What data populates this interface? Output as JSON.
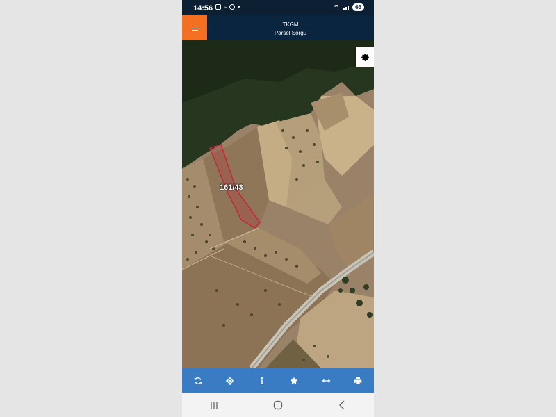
{
  "status_bar": {
    "time": "14:56",
    "battery": "66",
    "icons": [
      "screenshot-icon",
      "cast-icon",
      "messenger-icon",
      "dot-icon",
      "wifi-icon",
      "signal-icon",
      "battery-icon"
    ]
  },
  "header": {
    "title": "TKGM",
    "subtitle": "Parsel Sorgu",
    "menu_icon": "hamburger-icon",
    "accent_color": "#f36f21",
    "background_color": "#0a2540"
  },
  "map": {
    "parcel_label": "161/43",
    "parcel_color": "#c0283c",
    "settings_icon": "gear-icon"
  },
  "toolbar": {
    "background_color": "#3a7cc4",
    "buttons": [
      "refresh-icon",
      "locate-icon",
      "info-icon",
      "star-icon",
      "measure-icon",
      "print-icon"
    ]
  },
  "nav_bar": {
    "buttons": [
      "recent-apps-icon",
      "home-icon",
      "back-icon"
    ]
  }
}
